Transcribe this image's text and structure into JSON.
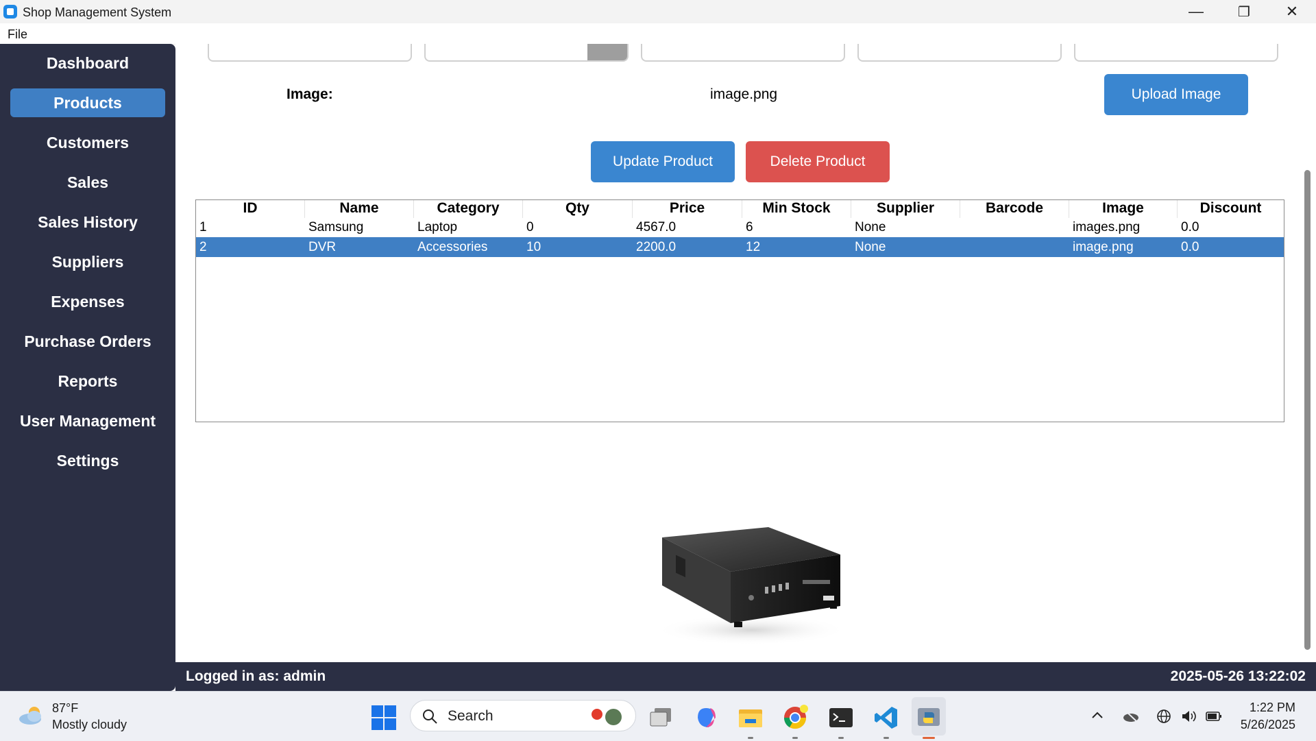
{
  "window": {
    "title": "Shop Management System",
    "minimize_glyph": "—",
    "maximize_glyph": "❐",
    "close_glyph": "✕"
  },
  "menu": {
    "file": "File"
  },
  "sidebar": {
    "items": [
      {
        "label": "Dashboard"
      },
      {
        "label": "Products",
        "active": true
      },
      {
        "label": "Customers"
      },
      {
        "label": "Sales"
      },
      {
        "label": "Sales History"
      },
      {
        "label": "Suppliers"
      },
      {
        "label": "Expenses"
      },
      {
        "label": "Purchase Orders"
      },
      {
        "label": "Reports"
      },
      {
        "label": "User Management"
      },
      {
        "label": "Settings"
      }
    ]
  },
  "form": {
    "image_label": "Image:",
    "image_file": "image.png",
    "upload_button": "Upload Image",
    "update_button": "Update Product",
    "delete_button": "Delete Product"
  },
  "table": {
    "columns": [
      "ID",
      "Name",
      "Category",
      "Qty",
      "Price",
      "Min Stock",
      "Supplier",
      "Barcode",
      "Image",
      "Discount"
    ],
    "rows": [
      [
        "1",
        "Samsung",
        "Laptop",
        "0",
        "4567.0",
        "6",
        "None",
        "",
        "images.png",
        "0.0"
      ],
      [
        "2",
        "DVR",
        "Accessories",
        "10",
        "2200.0",
        "12",
        "None",
        "",
        "image.png",
        "0.0"
      ]
    ],
    "selected_row": 1
  },
  "status": {
    "user": "Logged in as: admin",
    "datetime": "2025-05-26 13:22:02"
  },
  "taskbar": {
    "weather_temp": "87°F",
    "weather_desc": "Mostly cloudy",
    "search": "Search",
    "time": "1:22 PM",
    "date": "5/26/2025"
  },
  "colors": {
    "sidebar_bg": "#2b2f44",
    "accent_blue": "#3a86d0",
    "danger_red": "#dc524f",
    "selection": "#3f7fc4"
  }
}
